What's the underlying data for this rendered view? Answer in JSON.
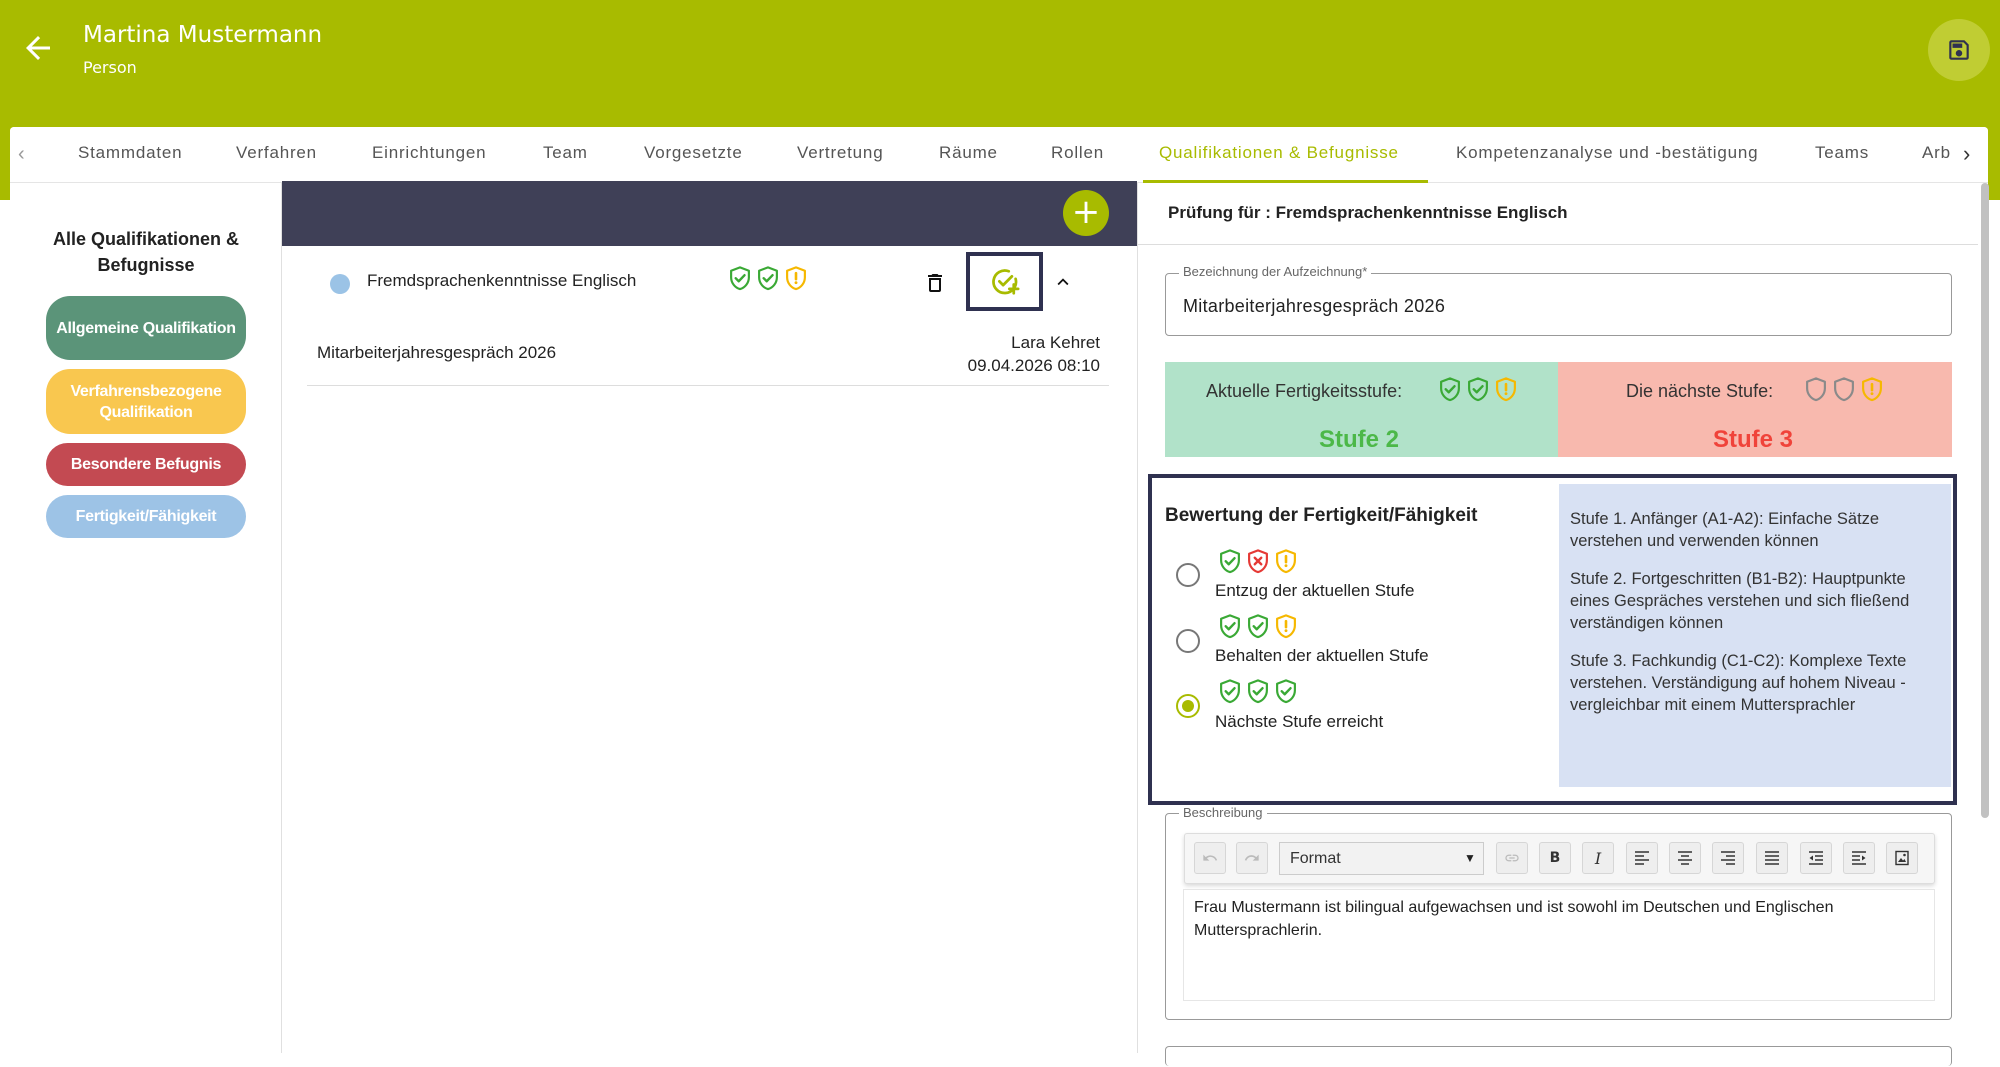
{
  "header": {
    "title": "Martina Mustermann",
    "subtitle": "Person",
    "color": "#a8bb00"
  },
  "tabs": [
    {
      "label": "Stammdaten"
    },
    {
      "label": "Verfahren"
    },
    {
      "label": "Einrichtungen"
    },
    {
      "label": "Team"
    },
    {
      "label": "Vorgesetzte"
    },
    {
      "label": "Vertretung"
    },
    {
      "label": "Räume"
    },
    {
      "label": "Rollen"
    },
    {
      "label": "Qualifikationen & Befugnisse",
      "active": true
    },
    {
      "label": "Kompetenzanalyse und -bestätigung"
    },
    {
      "label": "Teams"
    },
    {
      "label": "Arb"
    }
  ],
  "filter": {
    "title": "Alle Qualifikationen & Befugnisse",
    "pills": [
      {
        "label": "Allgemeine Qualifikation",
        "color": "#5b9479"
      },
      {
        "label": "Verfahrensbezogene Qualifikation",
        "color": "#f9c74f"
      },
      {
        "label": "Besondere Befugnis",
        "color": "#c34a52"
      },
      {
        "label": "Fertigkeit/Fähigkeit",
        "color": "#9dc3e6"
      }
    ]
  },
  "list": {
    "item": {
      "title": "Fremdsprachenkenntnisse Englisch",
      "dot_color": "#9bc3e6",
      "shields": [
        "check-green",
        "check-green",
        "exclaim-yellow"
      ]
    },
    "record": {
      "name": "Mitarbeiterjahresgespräch 2026",
      "author": "Lara Kehret",
      "date": "09.04.2026 08:10"
    }
  },
  "detail": {
    "title": "Prüfung für : Fremdsprachenkenntnisse Englisch",
    "record_field": {
      "label": "Bezeichnung der Aufzeichnung*",
      "value": "Mitarbeiterjahresgespräch 2026"
    },
    "current_level": {
      "label": "Aktuelle Fertigkeitsstufe:",
      "value": "Stufe 2",
      "shields": [
        "check-green",
        "check-green",
        "exclaim-yellow"
      ],
      "color": "#4cb848"
    },
    "next_level": {
      "label": "Die nächste Stufe:",
      "value": "Stufe 3",
      "shields": [
        "empty-grey",
        "empty-grey",
        "exclaim-yellow"
      ],
      "color": "#f0433a"
    },
    "rating": {
      "title": "Bewertung der Fertigkeit/Fähigkeit",
      "options": [
        {
          "label": "Entzug der aktuellen Stufe",
          "shields": [
            "check-green",
            "cross-red",
            "exclaim-yellow"
          ],
          "checked": false
        },
        {
          "label": "Behalten der aktuellen Stufe",
          "shields": [
            "check-green",
            "check-green",
            "exclaim-yellow"
          ],
          "checked": false
        },
        {
          "label": "Nächste Stufe erreicht",
          "shields": [
            "check-green",
            "check-green",
            "check-green"
          ],
          "checked": true
        }
      ],
      "levels_info": [
        "Stufe 1. Anfänger (A1-A2): Einfache Sätze verstehen und verwenden können",
        "Stufe 2. Fortgeschritten (B1-B2): Hauptpunkte eines Gespräches verstehen und sich fließend verständigen können",
        "Stufe 3. Fachkundig (C1-C2): Komplexe Texte verstehen. Verständigung auf hohem Niveau - vergleichbar mit einem Muttersprachler"
      ]
    },
    "description": {
      "label": "Beschreibung",
      "format_value": "Format",
      "toolbar": [
        "undo-icon",
        "redo-icon",
        "link-icon",
        "bold-icon",
        "italic-icon",
        "align-left-icon",
        "align-center-icon",
        "align-right-icon",
        "align-justify-icon",
        "outdent-icon",
        "indent-icon",
        "image-icon"
      ],
      "content": "Frau Mustermann ist bilingual aufgewachsen und ist sowohl im Deutschen und Englischen Muttersprachlerin."
    }
  }
}
